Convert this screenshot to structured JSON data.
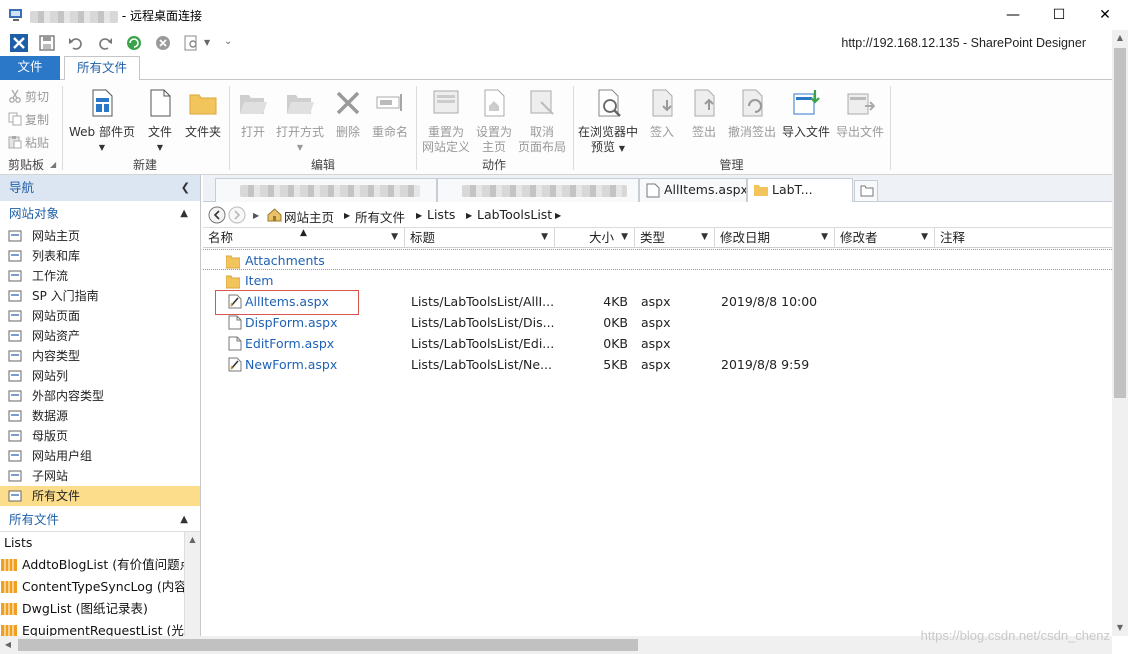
{
  "window": {
    "title": "- 远程桌面连接",
    "minimize": "—",
    "maximize": "☐",
    "close": "✕"
  },
  "qat": {
    "url_app": "http://192.168.12.135 - SharePoint Designer"
  },
  "ribbon_tabs": {
    "file": "文件",
    "all_files": "所有文件"
  },
  "ribbon": {
    "clipboard": {
      "cut": "剪切",
      "copy": "复制",
      "paste": "粘贴",
      "label": "剪贴板"
    },
    "new": {
      "web_part_page": "Web 部件页",
      "file": "文件",
      "folder": "文件夹",
      "label": "新建"
    },
    "edit": {
      "open": "打开",
      "open_with": "打开方式",
      "delete": "删除",
      "rename": "重命名",
      "label": "编辑"
    },
    "actions": {
      "reset_line1": "重置为",
      "reset_line2": "网站定义",
      "set_home_line1": "设置为",
      "set_home_line2": "主页",
      "cancel_layout_line1": "取消",
      "cancel_layout_line2": "页面布局",
      "label": "动作"
    },
    "manage": {
      "preview_line1": "在浏览器中",
      "preview_line2": "预览",
      "check_in": "签入",
      "check_out": "签出",
      "undo_checkout": "撤消签出",
      "import": "导入文件",
      "export": "导出文件",
      "label": "管理"
    }
  },
  "nav": {
    "header": "导航",
    "site_objects_header": "网站对象",
    "items": [
      "网站主页",
      "列表和库",
      "工作流",
      "SP 入门指南",
      "网站页面",
      "网站资产",
      "内容类型",
      "网站列",
      "外部内容类型",
      "数据源",
      "母版页",
      "网站用户组",
      "子网站",
      "所有文件"
    ],
    "all_files_header": "所有文件",
    "tree_root": "Lists",
    "tree_items": [
      "AddtoBlogList (有价值问题点",
      "ContentTypeSyncLog (内容类",
      "DwgList (图纸记录表)",
      "EquipmentRequestList (光学"
    ]
  },
  "doc_tabs": {
    "tab3": "AllItems.aspx",
    "tab4": "LabT..."
  },
  "breadcrumb": [
    "网站主页",
    "所有文件",
    "Lists",
    "LabToolsList"
  ],
  "columns": [
    "名称",
    "标题",
    "大小",
    "类型",
    "修改日期",
    "修改者",
    "注释"
  ],
  "rows": [
    {
      "name": "Attachments",
      "title": "",
      "size": "",
      "type": "",
      "modified": "",
      "icon": "folder-icon"
    },
    {
      "name": "Item",
      "title": "",
      "size": "",
      "type": "",
      "modified": "",
      "icon": "folder-icon"
    },
    {
      "name": "AllItems.aspx",
      "title": "Lists/LabToolsList/AllI...",
      "size": "4KB",
      "type": "aspx",
      "modified": "2019/8/8 10:00",
      "icon": "customized-page-icon"
    },
    {
      "name": "DispForm.aspx",
      "title": "Lists/LabToolsList/Dis...",
      "size": "0KB",
      "type": "aspx",
      "modified": "",
      "icon": "page-icon"
    },
    {
      "name": "EditForm.aspx",
      "title": "Lists/LabToolsList/Edi...",
      "size": "0KB",
      "type": "aspx",
      "modified": "",
      "icon": "page-icon"
    },
    {
      "name": "NewForm.aspx",
      "title": "Lists/LabToolsList/Ne...",
      "size": "5KB",
      "type": "aspx",
      "modified": "2019/8/8 9:59",
      "icon": "customized-page-icon"
    }
  ],
  "watermark": "https://blog.csdn.net/csdn_chenz",
  "colors": {
    "accent": "#2b78c9",
    "link": "#1e62b5",
    "selection": "#fcdd8c",
    "nav_header": "#dce6f2",
    "highlight_box": "#d9534f"
  }
}
